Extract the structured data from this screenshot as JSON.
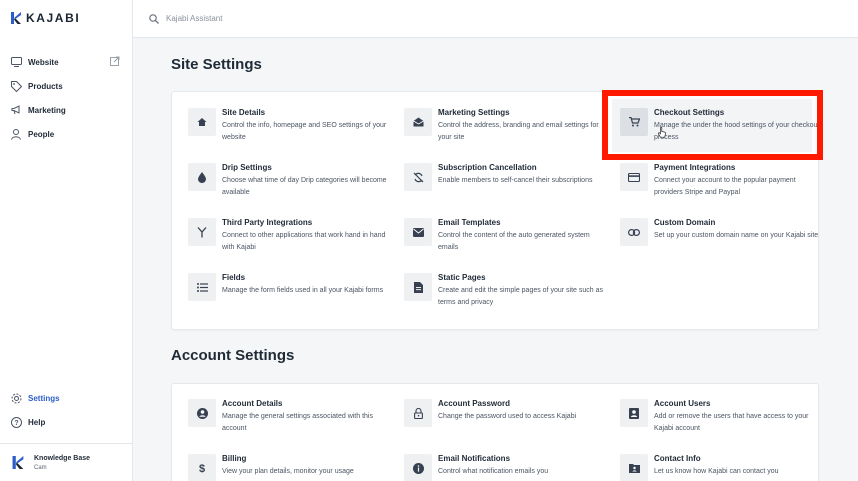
{
  "app": {
    "brand": "KAJABI",
    "accent": "#2b5ec9"
  },
  "sidebar": {
    "items": [
      {
        "label": "Website",
        "icon": "monitor-icon"
      },
      {
        "label": "Products",
        "icon": "tag-icon"
      },
      {
        "label": "Marketing",
        "icon": "megaphone-icon"
      },
      {
        "label": "People",
        "icon": "person-icon"
      }
    ],
    "bottom": [
      {
        "label": "Settings",
        "icon": "gear-icon",
        "active": true
      },
      {
        "label": "Help",
        "icon": "help-icon"
      }
    ],
    "knowledge_base": {
      "title": "Knowledge Base",
      "sub": "Cam"
    }
  },
  "search": {
    "placeholder": "Kajabi Assistant"
  },
  "site_settings": {
    "title": "Site Settings",
    "items": [
      {
        "title": "Site Details",
        "desc": "Control the info, homepage and SEO settings of your website",
        "icon": "home-icon"
      },
      {
        "title": "Marketing Settings",
        "desc": "Control the address, branding and email settings for your site",
        "icon": "envelope-open-icon"
      },
      {
        "title": "Checkout Settings",
        "desc": "Manage the under the hood settings of your checkout process",
        "icon": "cart-icon"
      },
      {
        "title": "Drip Settings",
        "desc": "Choose what time of day Drip categories will become available",
        "icon": "drop-icon"
      },
      {
        "title": "Subscription Cancellation",
        "desc": "Enable members to self-cancel their subscriptions",
        "icon": "sync-off-icon"
      },
      {
        "title": "Payment Integrations",
        "desc": "Connect your account to the popular payment providers Stripe and Paypal",
        "icon": "credit-card-icon"
      },
      {
        "title": "Third Party Integrations",
        "desc": "Connect to other applications that work hand in hand with Kajabi",
        "icon": "merge-icon"
      },
      {
        "title": "Email Templates",
        "desc": "Control the content of the auto generated system emails",
        "icon": "envelope-icon"
      },
      {
        "title": "Custom Domain",
        "desc": "Set up your custom domain name on your Kajabi site",
        "icon": "link-icon"
      },
      {
        "title": "Fields",
        "desc": "Manage the form fields used in all your Kajabi forms",
        "icon": "list-icon"
      },
      {
        "title": "Static Pages",
        "desc": "Create and edit the simple pages of your site such as terms and privacy",
        "icon": "document-icon"
      }
    ]
  },
  "account_settings": {
    "title": "Account Settings",
    "items": [
      {
        "title": "Account Details",
        "desc": "Manage the general settings associated with this account",
        "icon": "account-circle-icon"
      },
      {
        "title": "Account Password",
        "desc": "Change the password used to access Kajabi",
        "icon": "lock-icon"
      },
      {
        "title": "Account Users",
        "desc": "Add or remove the users that have access to your Kajabi account",
        "icon": "user-box-icon"
      },
      {
        "title": "Billing",
        "desc": "View your plan details, monitor your usage",
        "icon": "dollar-icon"
      },
      {
        "title": "Email Notifications",
        "desc": "Control what notification emails you",
        "icon": "info-icon"
      },
      {
        "title": "Contact Info",
        "desc": "Let us know how Kajabi can contact you",
        "icon": "contact-card-icon"
      }
    ]
  },
  "highlight_color": "#ff1a00"
}
